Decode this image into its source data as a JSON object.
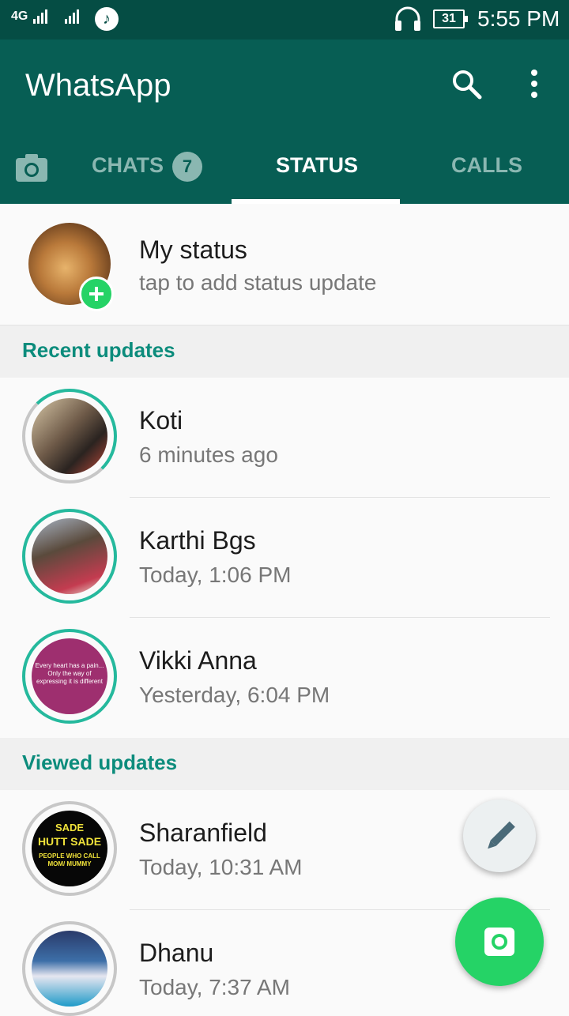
{
  "status_bar": {
    "signal_text": "4G",
    "time": "5:55 PM",
    "battery": "31"
  },
  "app": {
    "title": "WhatsApp"
  },
  "tabs": {
    "chats_label": "CHATS",
    "chats_badge": "7",
    "status_label": "STATUS",
    "calls_label": "CALLS",
    "active": "STATUS"
  },
  "my_status": {
    "name": "My status",
    "subtitle": "tap to add status update"
  },
  "sections": {
    "recent": "Recent updates",
    "viewed": "Viewed updates"
  },
  "recent_updates": [
    {
      "name": "Koti",
      "time": "6 minutes ago"
    },
    {
      "name": "Karthi Bgs",
      "time": "Today, 1:06 PM"
    },
    {
      "name": "Vikki Anna",
      "time": "Yesterday, 6:04 PM",
      "thumb_text": "Every heart has a pain... Only the way of expressing it is different"
    }
  ],
  "viewed_updates": [
    {
      "name": "Sharanfield",
      "time": "Today, 10:31 AM",
      "thumb_line1": "SADE",
      "thumb_line2": "HUTT SADE",
      "thumb_line3": "PEOPLE WHO CALL MOM/ MUMMY"
    },
    {
      "name": "Dhanu",
      "time": "Today, 7:37 AM"
    }
  ],
  "colors": {
    "header": "#075e54",
    "status_bar": "#054d44",
    "accent": "#25d366",
    "section_text": "#0c8c7c"
  },
  "icons": [
    "music-icon",
    "headset-icon",
    "battery-icon",
    "search-icon",
    "more-vert-icon",
    "camera-icon",
    "add-icon",
    "pencil-icon",
    "camera-fab-icon"
  ]
}
